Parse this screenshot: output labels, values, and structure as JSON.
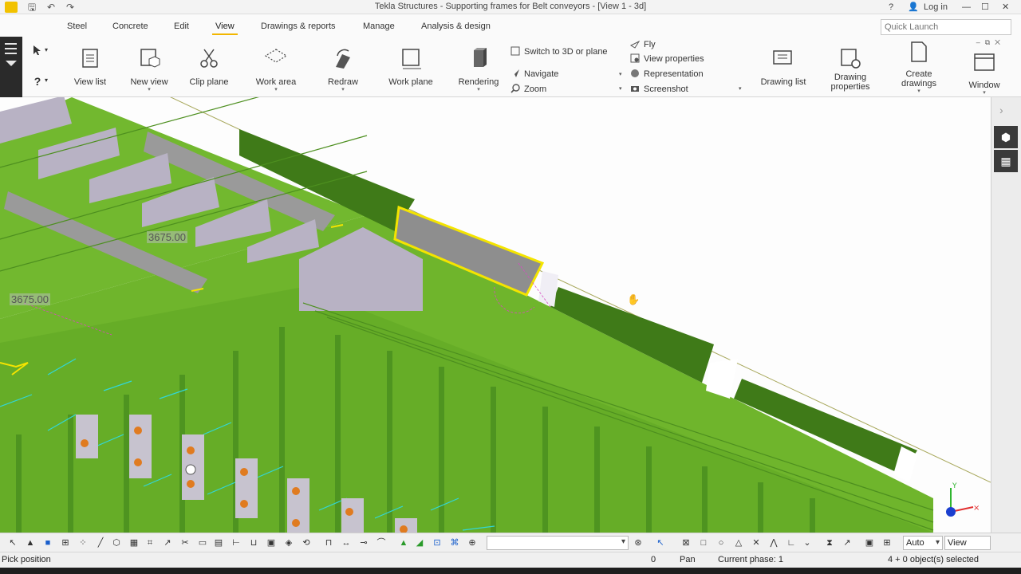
{
  "titlebar": {
    "title": "Tekla Structures - Supporting frames for Belt conveyors - [View 1 - 3d]",
    "help": "?",
    "login": "Log in",
    "minimize": "—",
    "maximize": "☐",
    "close": "✕"
  },
  "menu": {
    "tabs": [
      "Steel",
      "Concrete",
      "Edit",
      "View",
      "Drawings & reports",
      "Manage",
      "Analysis & design"
    ],
    "active": "View",
    "quick_launch_placeholder": "Quick Launch"
  },
  "ribbon": {
    "view_list": "View list",
    "new_view": "New view",
    "clip_plane": "Clip plane",
    "work_area": "Work area",
    "redraw": "Redraw",
    "work_plane": "Work plane",
    "rendering": "Rendering",
    "switch_3d": "Switch to 3D or plane",
    "navigate": "Navigate",
    "zoom": "Zoom",
    "fly": "Fly",
    "view_properties": "View properties",
    "representation": "Representation",
    "screenshot": "Screenshot",
    "drawing_list": "Drawing list",
    "drawing_properties_1": "Drawing",
    "drawing_properties_2": "properties",
    "create_drawings_1": "Create",
    "create_drawings_2": "drawings",
    "window": "Window"
  },
  "viewport": {
    "dim_1": "3675.00",
    "dim_2": "3675.00",
    "colors": {
      "beam_green": "#6fb52c",
      "beam_dark": "#3f7a18",
      "plate_lavender": "#b8b2c4",
      "grey_member": "#9a9a9a",
      "highlight_yellow": "#f4e400",
      "cyan_dim": "#31d7d7",
      "bolt_orange": "#e07b20"
    }
  },
  "bottombar": {
    "auto": "Auto",
    "view_plane": "View plane"
  },
  "status": {
    "prompt": "Pick position",
    "zero": "0",
    "pan": "Pan",
    "phase": "Current phase: 1",
    "selected": "4 + 0 object(s) selected"
  }
}
